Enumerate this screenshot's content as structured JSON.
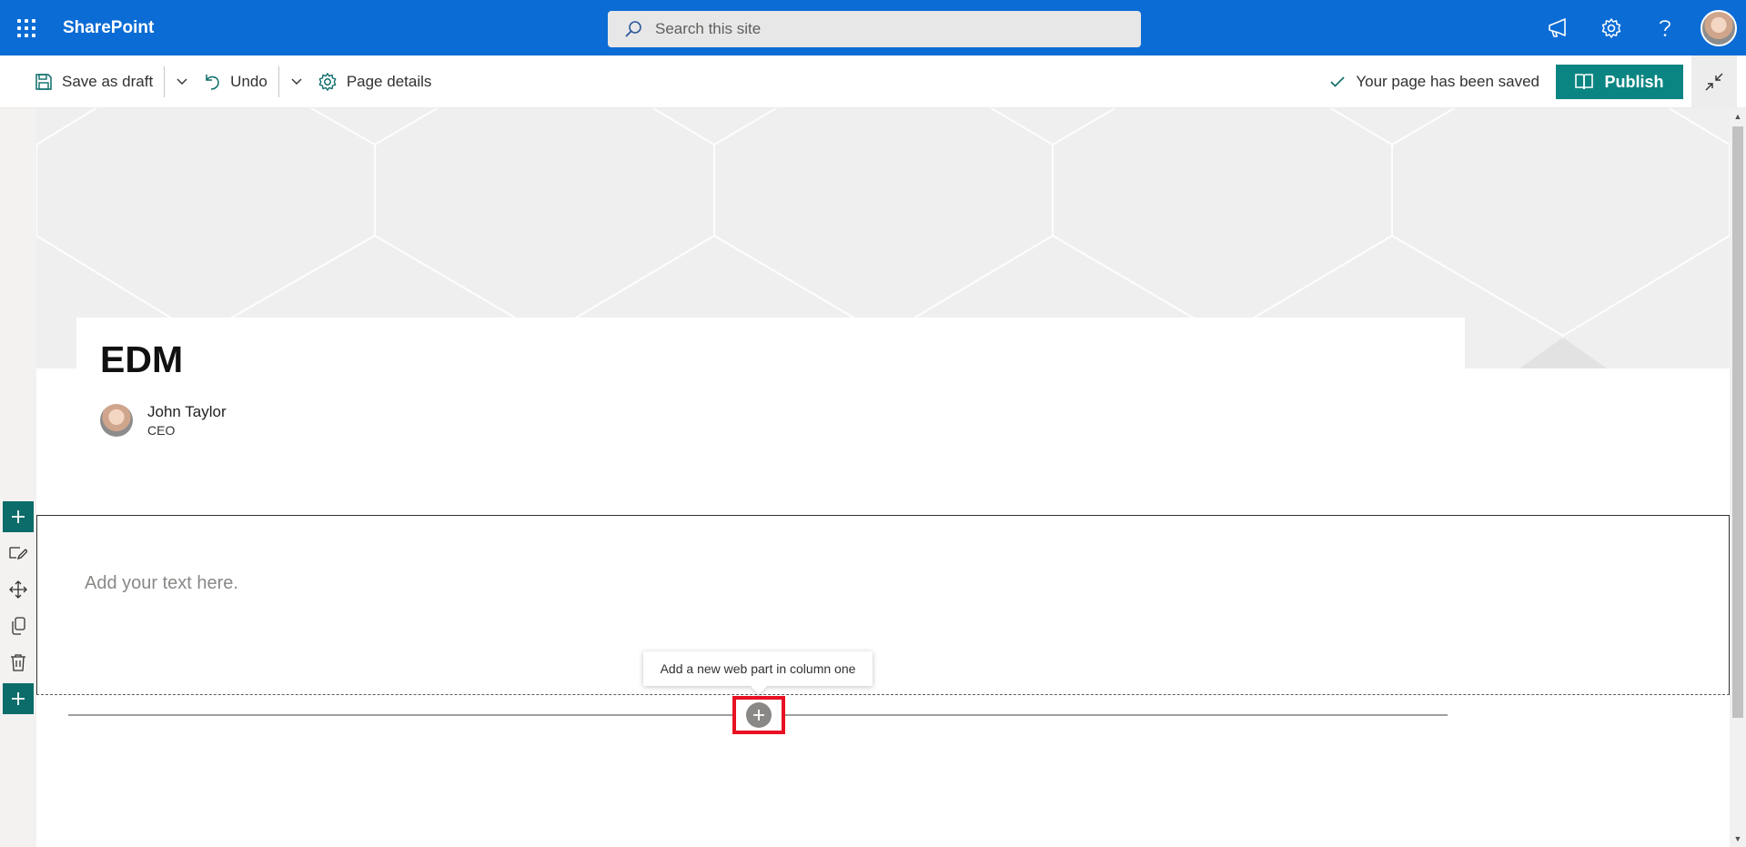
{
  "suitebar": {
    "app_name": "SharePoint",
    "search_placeholder": "Search this site",
    "icons": [
      "app-launcher-icon",
      "megaphone-icon",
      "gear-icon",
      "help-icon"
    ],
    "accent": "#0b6cd5"
  },
  "commandbar": {
    "save_draft": "Save as draft",
    "undo": "Undo",
    "page_details": "Page details",
    "saved_status": "Your page has been saved",
    "publish": "Publish",
    "publish_color": "#0b8582"
  },
  "page": {
    "title": "EDM",
    "author_name": "John Taylor",
    "author_role": "CEO",
    "text_placeholder": "Add your text here."
  },
  "tooltip": {
    "text": "Add a new web part in column one"
  }
}
